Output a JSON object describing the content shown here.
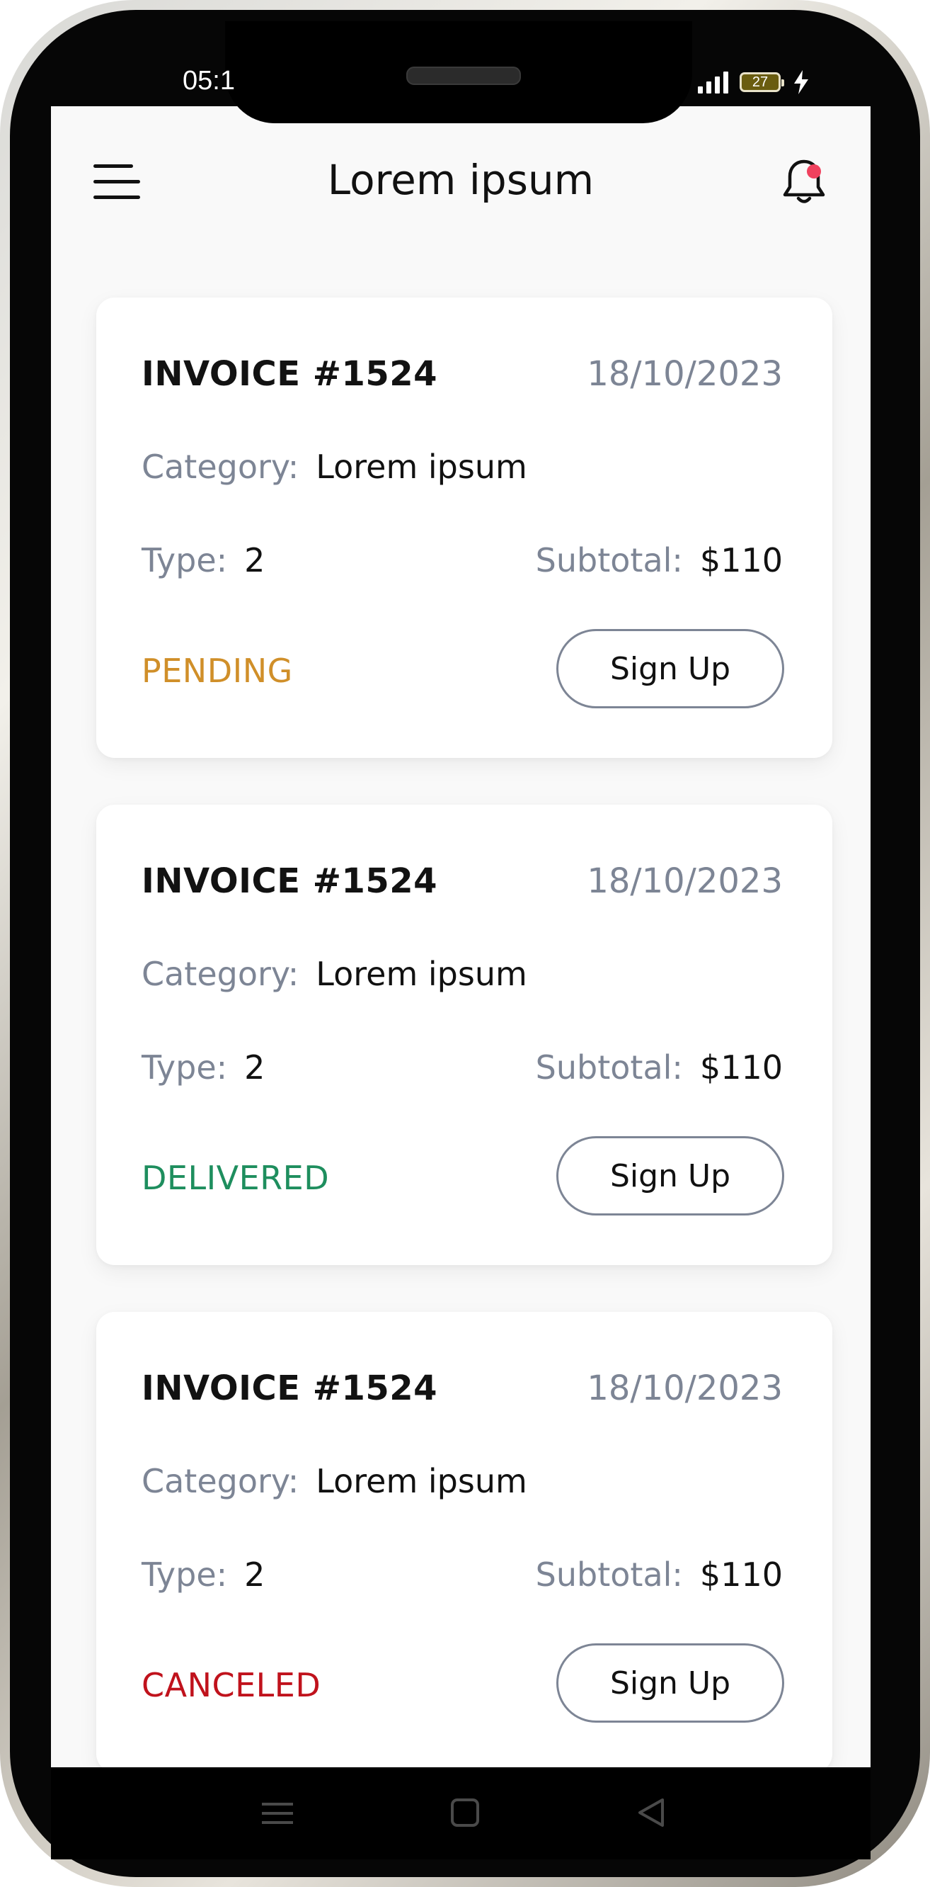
{
  "statusbar": {
    "time": "05:1",
    "battery": "27",
    "colors": {
      "battery_fill": "#6a5d10"
    }
  },
  "header": {
    "title": "Lorem ipsum",
    "menu_icon": "hamburger-menu-icon",
    "notification_icon": "bell-icon",
    "colors": {
      "notification_dot": "#f0415e"
    }
  },
  "invoices": [
    {
      "number": "INVOICE #1524",
      "date": "18/10/2023",
      "category_label": "Category:",
      "category_value": "Lorem ipsum",
      "type_label": "Type:",
      "type_value": "2",
      "subtotal_label": "Subtotal:",
      "subtotal_value": "$110",
      "status": "PENDING",
      "status_color": "#d08f29",
      "action_label": "Sign Up"
    },
    {
      "number": "INVOICE #1524",
      "date": "18/10/2023",
      "category_label": "Category:",
      "category_value": "Lorem ipsum",
      "type_label": "Type:",
      "type_value": "2",
      "subtotal_label": "Subtotal:",
      "subtotal_value": "$110",
      "status": "DELIVERED",
      "status_color": "#1e8e5e",
      "action_label": "Sign Up"
    },
    {
      "number": "INVOICE #1524",
      "date": "18/10/2023",
      "category_label": "Category:",
      "category_value": "Lorem ipsum",
      "type_label": "Type:",
      "type_value": "2",
      "subtotal_label": "Subtotal:",
      "subtotal_value": "$110",
      "status": "CANCELED",
      "status_color": "#c0121c",
      "action_label": "Sign Up"
    }
  ],
  "navbar": {
    "recents_icon": "recents-menu-icon",
    "home_icon": "home-square-icon",
    "back_icon": "back-triangle-icon"
  }
}
